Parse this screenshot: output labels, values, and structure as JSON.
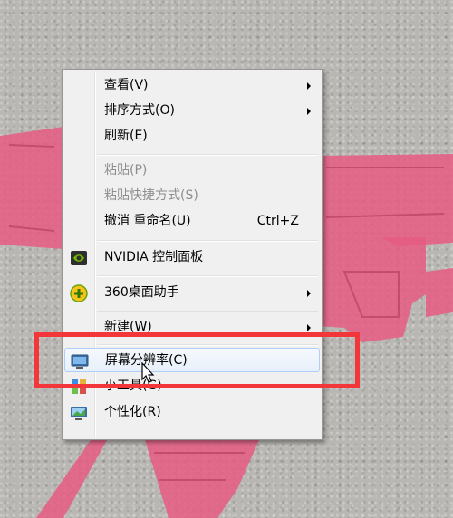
{
  "colors": {
    "wallpaper": "#b9b7b3",
    "wallpaper_graphic": "#e65c82",
    "annotation": "#f2363a",
    "menu_background": "#f0f0f0"
  },
  "context_menu": {
    "items": [
      {
        "label": "查看(V)",
        "submenu": true
      },
      {
        "label": "排序方式(O)",
        "submenu": true
      },
      {
        "label": "刷新(E)"
      },
      {
        "label": "粘贴(P)",
        "disabled": true
      },
      {
        "label": "粘贴快捷方式(S)",
        "disabled": true
      },
      {
        "label": "撤消 重命名(U)",
        "shortcut": "Ctrl+Z"
      },
      {
        "label": "NVIDIA 控制面板",
        "icon": "nvidia-icon"
      },
      {
        "label": "360桌面助手",
        "icon": "360-assistant-icon",
        "submenu": true
      },
      {
        "label": "新建(W)",
        "submenu": true
      },
      {
        "label": "屏幕分辨率(C)",
        "icon": "monitor-icon",
        "highlighted": true
      },
      {
        "label": "小工具(G)",
        "icon": "gadgets-icon"
      },
      {
        "label": "个性化(R)",
        "icon": "personalize-icon"
      }
    ]
  }
}
